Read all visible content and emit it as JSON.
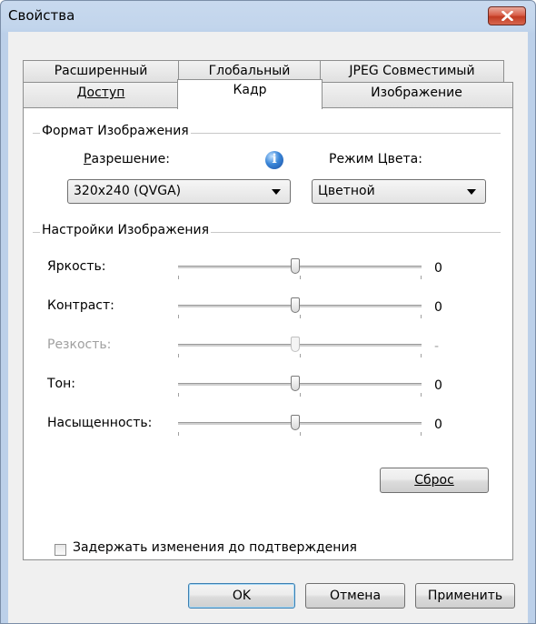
{
  "window": {
    "title": "Свойства"
  },
  "tabs": {
    "row1": [
      {
        "label": "Расширенный"
      },
      {
        "label": "Глобальный"
      },
      {
        "label": "JPEG Совместимый"
      }
    ],
    "row2": [
      {
        "label": "Доступ"
      },
      {
        "label": "Кадр"
      },
      {
        "label": "Изображение"
      }
    ],
    "active": "Кадр"
  },
  "format_group": {
    "title": "Формат Изображения",
    "resolution_label": "Разрешение:",
    "resolution_value": "320x240 (QVGA)",
    "color_mode_label": "Режим Цвета:",
    "color_mode_value": "Цветной"
  },
  "settings_group": {
    "title": "Настройки Изображения",
    "sliders": [
      {
        "label": "Яркость:",
        "value": "0",
        "enabled": true
      },
      {
        "label": "Контраст:",
        "value": "0",
        "enabled": true
      },
      {
        "label": "Резкость:",
        "value": "-",
        "enabled": false
      },
      {
        "label": "Тон:",
        "value": "0",
        "enabled": true
      },
      {
        "label": "Насыщенность:",
        "value": "0",
        "enabled": true
      }
    ],
    "reset_label": "Сброс"
  },
  "hold_changes": {
    "label": "Задержать изменения до подтверждения",
    "checked": false
  },
  "buttons": {
    "ok": "OK",
    "cancel": "Отмена",
    "apply": "Применить"
  }
}
